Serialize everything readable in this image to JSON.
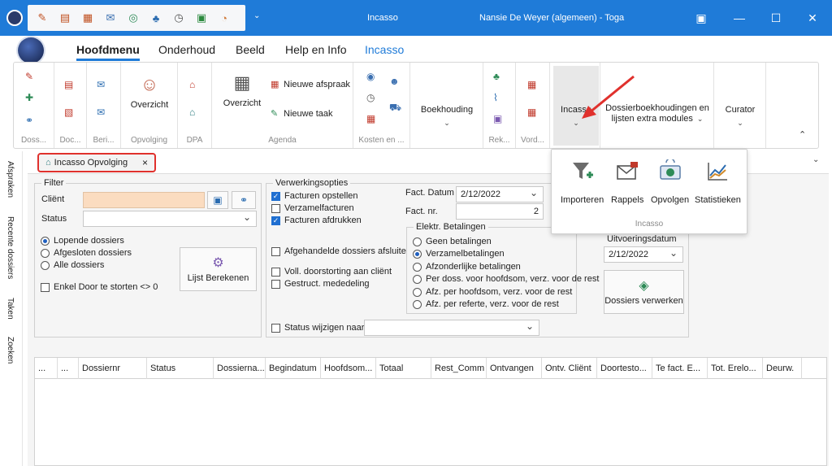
{
  "titlebar": {
    "app_name": "Incasso",
    "user": "Nansie De Weyer (algemeen) - Toga",
    "qat_dropdown": "⌄"
  },
  "colors": {
    "titlebar": "#1f7bd8",
    "accent": "#1f7bd8",
    "highlight_box": "#e0312d",
    "arrow": "#e0312d",
    "client_field": "#fbdcc0"
  },
  "tabs": [
    {
      "label": "Hoofdmenu",
      "active": true
    },
    {
      "label": "Onderhoud"
    },
    {
      "label": "Beeld"
    },
    {
      "label": "Help en Info"
    },
    {
      "label": "Incasso",
      "contextual": true
    }
  ],
  "ribbon": {
    "groups": [
      {
        "label": "Doss..."
      },
      {
        "label": "Doc..."
      },
      {
        "label": "Beri..."
      },
      {
        "label": "Opvolging",
        "button": "Overzicht"
      },
      {
        "label": "DPA"
      },
      {
        "label": "Agenda",
        "button": "Overzicht",
        "new_appointment": "Nieuwe afspraak",
        "new_task": "Nieuwe taak"
      },
      {
        "label": "Kosten en ..."
      },
      {
        "label": "",
        "dropdown": "Boekhouding"
      },
      {
        "label": "Rek..."
      },
      {
        "label": "Vord..."
      },
      {
        "label": "",
        "dropdown": "Incasso"
      },
      {
        "label": "",
        "dropdown": "Dossierboekhoudingen en lijsten extra modules"
      },
      {
        "label": "",
        "dropdown": "Curator"
      }
    ],
    "collapse": "⌃"
  },
  "incasso_popup": {
    "items": [
      {
        "label": "Importeren",
        "icon": "filter-add-icon"
      },
      {
        "label": "Rappels",
        "icon": "envelope-icon"
      },
      {
        "label": "Opvolgen",
        "icon": "money-icon"
      },
      {
        "label": "Statistieken",
        "icon": "chart-icon"
      }
    ],
    "group_label": "Incasso"
  },
  "side_tabs": [
    "Afspraken",
    "Recente dossiers",
    "Taken",
    "Zoeken"
  ],
  "doc_tab": {
    "label": "Incasso Opvolging",
    "close": "×"
  },
  "filter": {
    "legend": "Filter",
    "client_label": "Cliënt",
    "client_value": "",
    "status_label": "Status",
    "status_value": "",
    "radios": [
      {
        "label": "Lopende dossiers",
        "checked": true
      },
      {
        "label": "Afgesloten dossiers",
        "checked": false
      },
      {
        "label": "Alle dossiers",
        "checked": false
      }
    ],
    "enkel_label": "Enkel Door te storten <> 0",
    "compute_button": "Lijst Berekenen"
  },
  "processing": {
    "legend": "Verwerkingsopties",
    "checks": [
      {
        "label": "Facturen opstellen",
        "checked": true
      },
      {
        "label": "Verzamelfacturen",
        "checked": false
      },
      {
        "label": "Facturen afdrukken",
        "checked": true
      }
    ],
    "afgehandelde": "Afgehandelde dossiers afsluiten",
    "voll": "Voll. doorstorting aan cliënt",
    "gestruct": "Gestruct. mededeling",
    "status_wijzigen": "Status wijzigen naar",
    "status_wijzigen_value": "",
    "fact_datum_label": "Fact. Datum",
    "fact_datum": "2/12/2022",
    "fact_nr_label": "Fact. nr.",
    "fact_nr": "2",
    "elektr_legend": "Elektr. Betalingen",
    "payments": [
      {
        "label": "Geen betalingen",
        "checked": false
      },
      {
        "label": "Verzamelbetalingen",
        "checked": true
      },
      {
        "label": "Afzonderlijke betalingen",
        "checked": false
      },
      {
        "label": "Per doss. voor hoofdsom, verz. voor de rest",
        "checked": false
      },
      {
        "label": "Afz. per hoofdsom, verz. voor de rest",
        "checked": false
      },
      {
        "label": "Afz. per referte, verz. voor de rest",
        "checked": false
      }
    ],
    "uitvoering_label": "Uitvoeringsdatum",
    "uitvoering_value": "2/12/2022",
    "process_button": "Dossiers verwerken"
  },
  "grid": {
    "columns": [
      "...",
      "...",
      "Dossiernr",
      "Status",
      "Dossierna...",
      "Begindatum",
      "Hoofdsom...",
      "Totaal",
      "Rest_Comm",
      "Ontvangen",
      "Ontv. Cliënt",
      "Doortesto...",
      "Te fact. E...",
      "Tot. Erelo...",
      "Deurw."
    ]
  }
}
